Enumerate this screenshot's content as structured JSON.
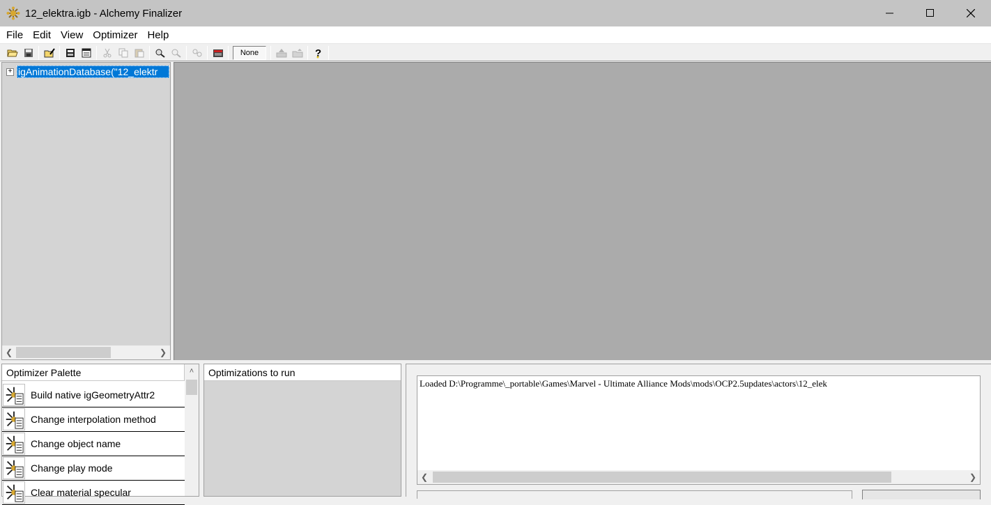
{
  "window": {
    "title": "12_elektra.igb - Alchemy Finalizer",
    "minimize": "minimize",
    "maximize": "maximize",
    "close": "close"
  },
  "menu": [
    "File",
    "Edit",
    "View",
    "Optimizer",
    "Help"
  ],
  "toolbar": {
    "buttons": [
      "open-icon",
      "save-icon",
      "edit-icon",
      "export-icon",
      "properties-icon",
      "cut-icon",
      "copy-icon",
      "paste-icon",
      "find-icon",
      "find-next-icon",
      "optimize-icon",
      "record-icon",
      "up-icon",
      "folder-up-icon",
      "help-icon"
    ],
    "dropdown_value": "None"
  },
  "tree": {
    "root_label": "igAnimationDatabase(\"12_elektr"
  },
  "palette": {
    "header": "Optimizer Palette",
    "items": [
      "Build native igGeometryAttr2",
      "Change interpolation method",
      "Change object name",
      "Change play mode",
      "Clear material specular"
    ]
  },
  "optimizations": {
    "header": "Optimizations to run"
  },
  "log": {
    "text": "Loaded D:\\Programme\\_portable\\Games\\Marvel - Ultimate Alliance Mods\\mods\\OCP2.5updates\\actors\\12_elek"
  }
}
